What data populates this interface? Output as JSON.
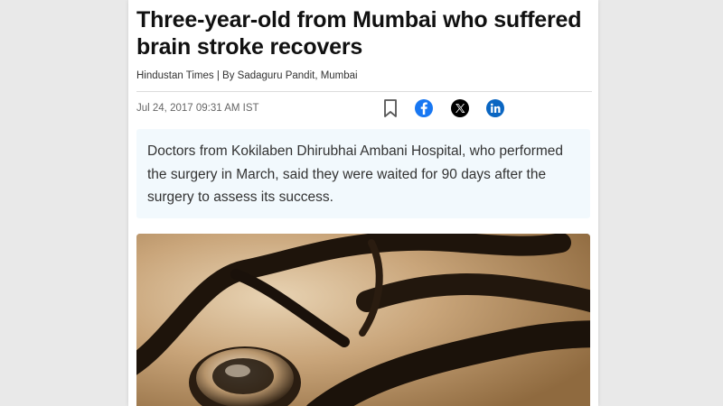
{
  "article": {
    "headline": "Three-year-old from Mumbai who suffered brain stroke recovers",
    "byline": "Hindustan Times | By Sadaguru Pandit, Mumbai",
    "date": "Jul 24, 2017 09:31 AM IST",
    "summary": "Doctors from Kokilaben Dhirubhai Ambani Hospital, who performed the surgery in March, said they were waited for 90 days after the surgery to assess its success.",
    "image_subject": "stethoscope"
  },
  "share": {
    "icons": [
      "bookmark-icon",
      "facebook-icon",
      "x-icon",
      "linkedin-icon"
    ]
  },
  "colors": {
    "page_bg": "#ffffff",
    "backdrop": "#e9e9e9",
    "summary_bg": "#f2f9fd",
    "facebook": "#1877f2",
    "x": "#000000",
    "linkedin": "#0a66c2",
    "bookmark": "#555555",
    "image_tone": "#b48e5c"
  }
}
